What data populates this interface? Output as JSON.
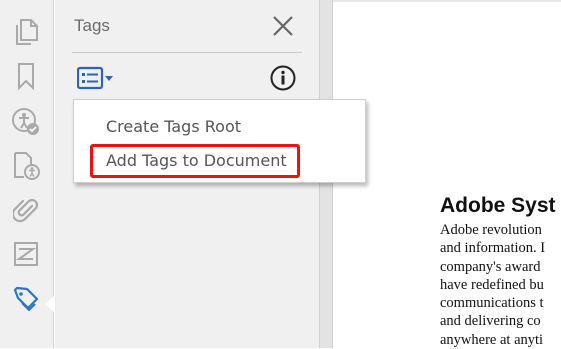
{
  "rail": {
    "items": [
      {
        "name": "pages-icon"
      },
      {
        "name": "bookmark-icon"
      },
      {
        "name": "accessibility-check-icon"
      },
      {
        "name": "reading-order-icon"
      },
      {
        "name": "attachment-icon"
      },
      {
        "name": "content-icon"
      },
      {
        "name": "tags-icon",
        "active": true
      }
    ],
    "active_color": "#2d74c9",
    "icon_color": "#a9a9a9"
  },
  "panel": {
    "title": "Tags"
  },
  "menu": {
    "items": [
      {
        "label": "Create Tags Root",
        "mnemonic": "r"
      },
      {
        "label": "Add Tags to Document",
        "mnemonic": "A"
      }
    ],
    "highlighted_item": "Add Tags to Document",
    "highlight_color": "#ee1111"
  },
  "document": {
    "heading": "Adobe Syst",
    "lines": [
      "Adobe revolution",
      "and information. I",
      "company's award",
      "have redefined bu",
      "communications t",
      "and delivering co",
      "anywhere at anyti"
    ]
  }
}
